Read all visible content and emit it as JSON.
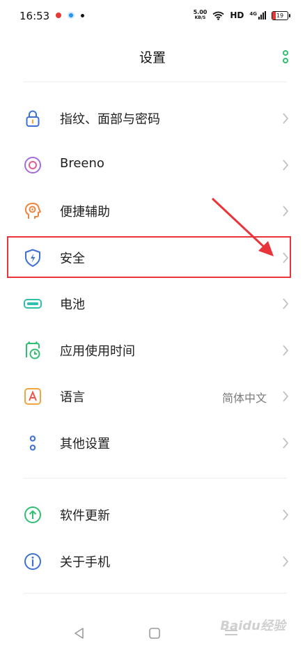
{
  "status_bar": {
    "time": "16:53",
    "net_speed_value": "5.00",
    "net_speed_unit": "KB/S",
    "hd": "HD",
    "network": "4G",
    "battery": "19"
  },
  "header": {
    "title": "设置"
  },
  "settings": {
    "items": [
      {
        "label": "指纹、面部与密码",
        "icon": "lock-icon"
      },
      {
        "label": "Breeno",
        "icon": "breeno-icon"
      },
      {
        "label": "便捷辅助",
        "icon": "assist-icon"
      },
      {
        "label": "安全",
        "icon": "shield-icon"
      },
      {
        "label": "电池",
        "icon": "battery-icon"
      },
      {
        "label": "应用使用时间",
        "icon": "screen-time-icon"
      },
      {
        "label": "语言",
        "value": "简体中文",
        "icon": "language-icon"
      },
      {
        "label": "其他设置",
        "icon": "more-settings-icon"
      },
      {
        "label": "软件更新",
        "icon": "update-icon"
      },
      {
        "label": "关于手机",
        "icon": "info-icon"
      }
    ]
  },
  "watermark": "Baidu经验",
  "colors": {
    "accent_green": "#2fbf71",
    "icon_blue": "#3d6fd6",
    "annotation_red": "#e8343a"
  }
}
